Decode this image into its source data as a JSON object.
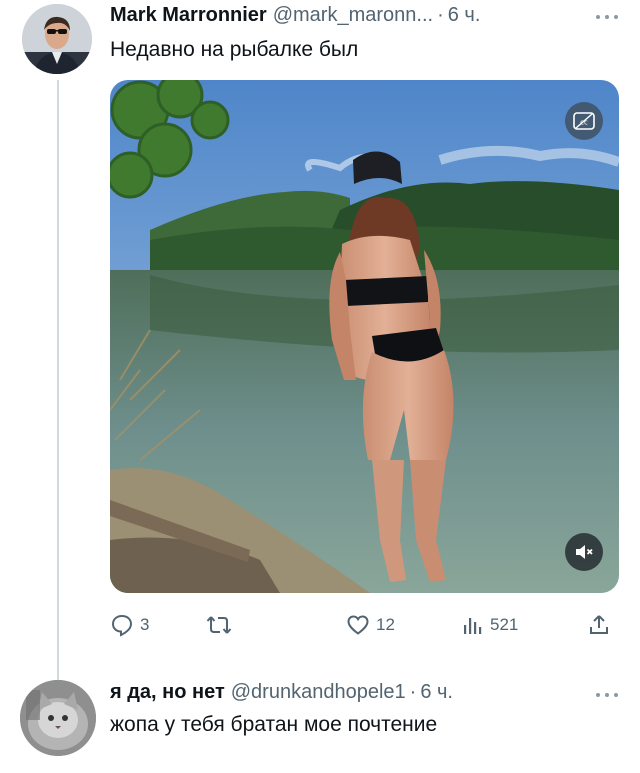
{
  "tweet": {
    "author_name": "Mark Marronnier",
    "handle": "@mark_maronn...",
    "separator": "·",
    "time": "6 ч.",
    "text": "Недавно на рыбалке был",
    "actions": {
      "replies": "3",
      "likes": "12",
      "views": "521"
    }
  },
  "reply": {
    "author_name": "я да, но нет",
    "handle": "@drunkandhopele1",
    "separator": "·",
    "time": "6 ч.",
    "text": "жопа у тебя братан мое почтение"
  },
  "colors": {
    "text_primary": "#0f1419",
    "text_secondary": "#536471",
    "thread_line": "#cfd9de"
  },
  "icons": [
    "more-icon",
    "reply-icon",
    "retweet-icon",
    "like-icon",
    "views-icon",
    "share-icon",
    "cc-icon",
    "mute-icon"
  ]
}
